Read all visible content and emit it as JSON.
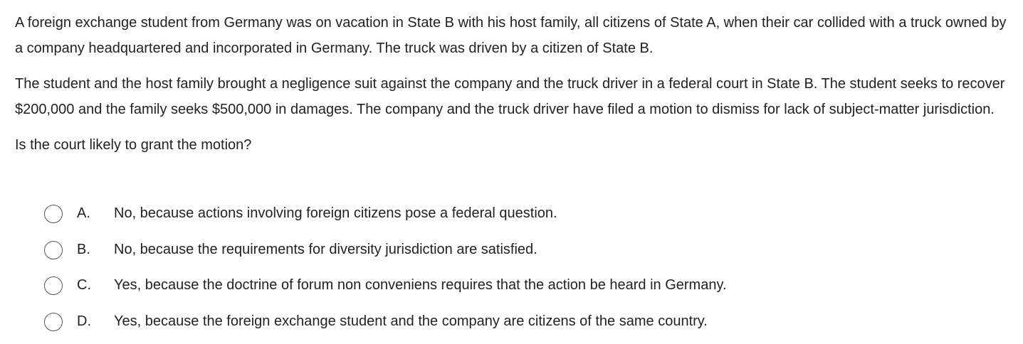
{
  "question": {
    "paragraphs": [
      "A foreign exchange student from Germany was on vacation in State B with his host family, all citizens of State A, when their car collided with a truck owned by a company headquartered and incorporated in Germany.  The truck was driven by a citizen of State B.",
      "The student and the host family brought a negligence suit against the company and the truck driver in a federal court in State B.  The student seeks to recover $200,000 and the family seeks $500,000 in damages.  The company and the truck driver have filed a motion to dismiss for lack of subject-matter jurisdiction.",
      "Is the court likely to grant the motion?"
    ]
  },
  "choices": [
    {
      "letter": "A.",
      "text": "No, because actions involving foreign citizens pose a federal question."
    },
    {
      "letter": "B.",
      "text": "No, because the requirements for diversity jurisdiction are satisfied."
    },
    {
      "letter": "C.",
      "text": "Yes, because the doctrine of forum non conveniens requires that the action be heard in Germany."
    },
    {
      "letter": "D.",
      "text": "Yes, because the foreign exchange student and the company are citizens of the same country."
    }
  ],
  "selected_choice": null
}
